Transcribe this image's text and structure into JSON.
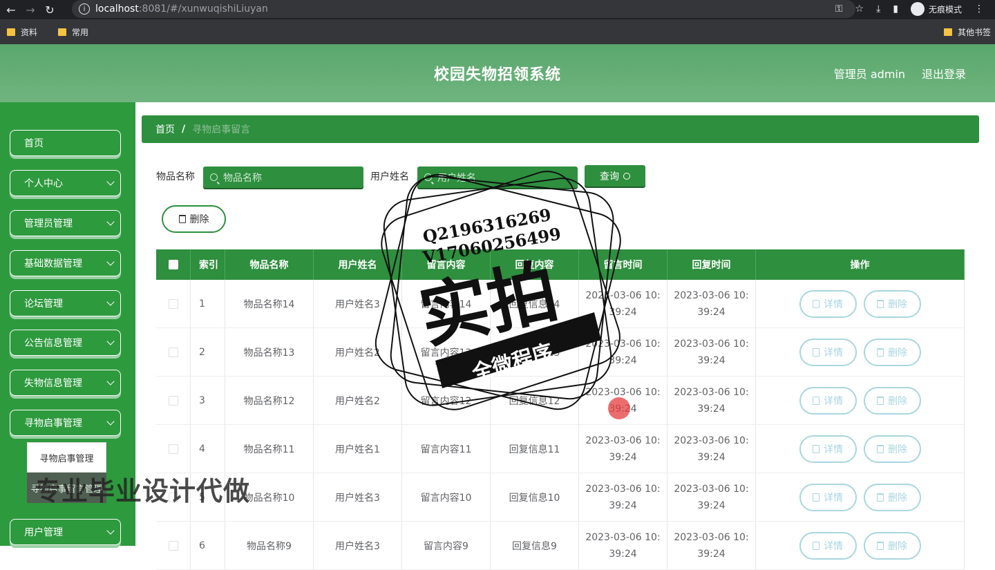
{
  "browser": {
    "url_host": "localhost",
    "url_path": ":8081/#/xunwuqishiLiuyan",
    "incognito_label": "无痕模式",
    "bookmarks": [
      "资料",
      "常用"
    ],
    "other_bookmarks": "其他书签"
  },
  "header": {
    "title": "校园失物招领系统",
    "user": "管理员 admin",
    "logout": "退出登录"
  },
  "sidebar": {
    "items": [
      {
        "label": "首页",
        "has_children": false
      },
      {
        "label": "个人中心",
        "has_children": true
      },
      {
        "label": "管理员管理",
        "has_children": true
      },
      {
        "label": "基础数据管理",
        "has_children": true
      },
      {
        "label": "论坛管理",
        "has_children": true
      },
      {
        "label": "公告信息管理",
        "has_children": true
      },
      {
        "label": "失物信息管理",
        "has_children": true
      },
      {
        "label": "寻物启事管理",
        "has_children": true
      },
      {
        "label": "用户管理",
        "has_children": true
      }
    ],
    "submenu": {
      "active": "寻物启事管理",
      "second": "寻物启事留言管理"
    }
  },
  "breadcrumb": {
    "home": "首页",
    "sep": "/",
    "current": "寻物启事留言"
  },
  "search": {
    "item_name_label": "物品名称",
    "item_name_placeholder": "物品名称",
    "user_name_label": "用户姓名",
    "user_name_placeholder": "用户姓名",
    "query_button": "查询"
  },
  "toolbar": {
    "delete_label": "删除"
  },
  "table": {
    "headers": [
      "索引",
      "物品名称",
      "用户姓名",
      "留言内容",
      "回复内容",
      "留言时间",
      "回复时间",
      "操作"
    ],
    "detail_label": "详情",
    "delete_label": "删除",
    "rows": [
      {
        "idx": "1",
        "item": "物品名称14",
        "user": "用户姓名3",
        "msg": "留言内容14",
        "reply": "回复信息14",
        "t1a": "2023-03-06 10:",
        "t1b": "39:24",
        "t2a": "2023-03-06 10:",
        "t2b": "39:24"
      },
      {
        "idx": "2",
        "item": "物品名称13",
        "user": "用户姓名2",
        "msg": "留言内容13",
        "reply": "回复信息13",
        "t1a": "2023-03-06 10:",
        "t1b": "39:24",
        "t2a": "2023-03-06 10:",
        "t2b": "39:24"
      },
      {
        "idx": "3",
        "item": "物品名称12",
        "user": "用户姓名2",
        "msg": "留言内容12",
        "reply": "回复信息12",
        "t1a": "2023-03-06 10:",
        "t1b": "39:24",
        "t2a": "2023-03-06 10:",
        "t2b": "39:24"
      },
      {
        "idx": "4",
        "item": "物品名称11",
        "user": "用户姓名1",
        "msg": "留言内容11",
        "reply": "回复信息11",
        "t1a": "2023-03-06 10:",
        "t1b": "39:24",
        "t2a": "2023-03-06 10:",
        "t2b": "39:24"
      },
      {
        "idx": "5",
        "item": "物品名称10",
        "user": "用户姓名3",
        "msg": "留言内容10",
        "reply": "回复信息10",
        "t1a": "2023-03-06 10:",
        "t1b": "39:24",
        "t2a": "2023-03-06 10:",
        "t2b": "39:24"
      },
      {
        "idx": "6",
        "item": "物品名称9",
        "user": "用户姓名3",
        "msg": "留言内容9",
        "reply": "回复信息9",
        "t1a": "2023-03-06 10:",
        "t1b": "39:24",
        "t2a": "2023-03-06 10:",
        "t2b": "39:24"
      }
    ]
  },
  "watermark": {
    "line1": "Q2196316269",
    "line2": "V17060256499",
    "main": "实拍",
    "banner": "全微程序",
    "caption": "专业毕业设计代做"
  },
  "colors": {
    "primary_green": "#2e8f3e",
    "header_green": "#6fb47f",
    "op_button_border": "#a9d6df"
  }
}
